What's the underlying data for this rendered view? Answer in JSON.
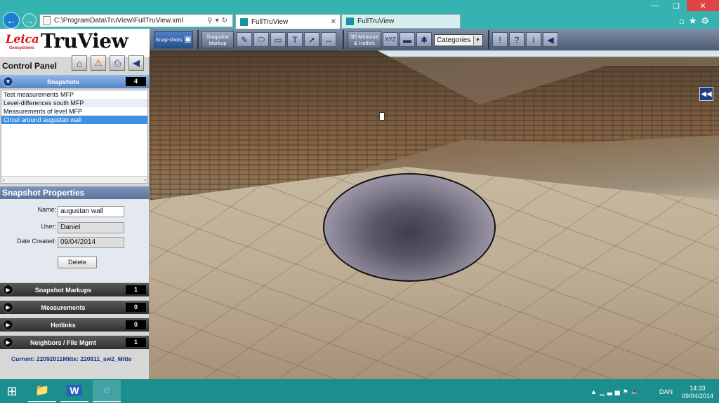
{
  "browser": {
    "address": "C:\\ProgramData\\TruView\\FullTruView.xml",
    "tabs": [
      {
        "label": "FullTruView",
        "active": true
      },
      {
        "label": "FullTruView",
        "active": false
      }
    ]
  },
  "app": {
    "brand": "Leica",
    "brand_sub": "Geosystems",
    "product": "TruView",
    "control_panel_title": "Control Panel"
  },
  "snapshots": {
    "header": "Snapshots",
    "count": "4",
    "items": [
      "Test measurements MFP",
      "Level-differences south MFP",
      "Measurements of level MFP",
      "Circel around augustan wall"
    ],
    "selected_index": 3
  },
  "properties": {
    "header": "Snapshot Properties",
    "name_label": "Name:",
    "name_value": "augustan wall",
    "user_label": "User:",
    "user_value": "Daniel",
    "date_label": "Date Created:",
    "date_value": "09/04/2014",
    "delete_label": "Delete"
  },
  "sections": [
    {
      "label": "Snapshot Markups",
      "count": "1"
    },
    {
      "label": "Measurements",
      "count": "0"
    },
    {
      "label": "Hotlinks",
      "count": "0"
    },
    {
      "label": "Neighbors / File Mgmt",
      "count": "1"
    }
  ],
  "current": "Current: 22092011Mitte: 220911_sw2_Mitte",
  "toolbar": {
    "snapshots_label": "Snap-shots",
    "snapshot_markup_label": "Snapshot Markup",
    "measure_label": "3D Measure & Hotlink",
    "categories_label": "Categories"
  },
  "taskbar": {
    "lang": "DAN",
    "time": "14:33",
    "date": "09/04/2014"
  },
  "colors": {
    "accent": "#35b3b0",
    "selected": "#3d8fe0",
    "brand_red": "#d3151b"
  }
}
